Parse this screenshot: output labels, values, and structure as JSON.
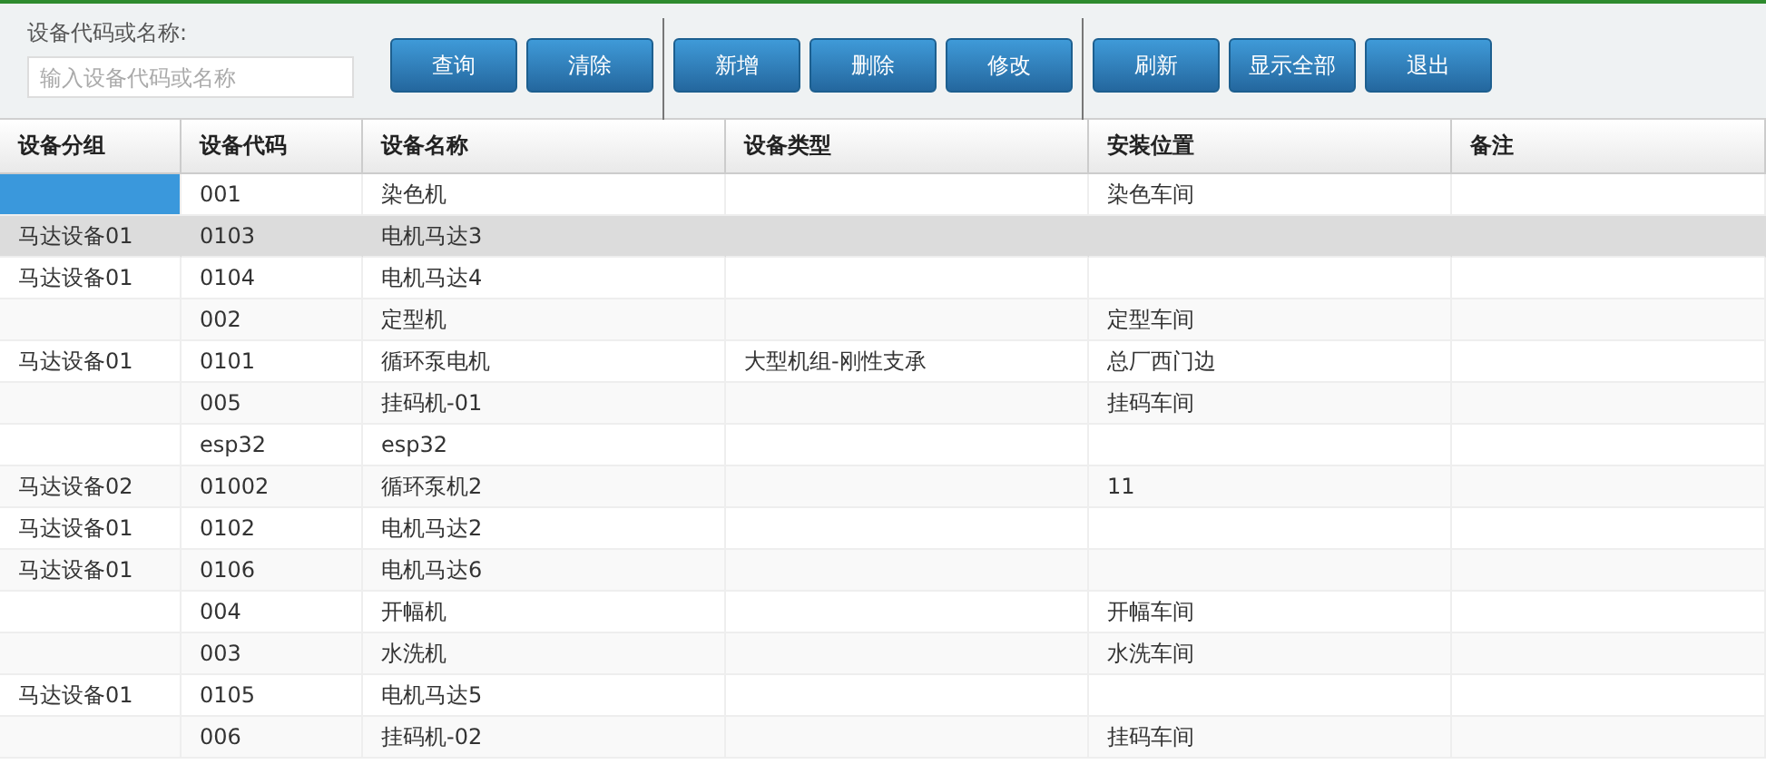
{
  "search": {
    "label": "设备代码或名称:",
    "placeholder": "输入设备代码或名称"
  },
  "button_groups": [
    [
      "查询",
      "清除"
    ],
    [
      "新增",
      "删除",
      "修改"
    ],
    [
      "刷新",
      "显示全部",
      "退出"
    ]
  ],
  "table": {
    "columns": [
      "设备分组",
      "设备代码",
      "设备名称",
      "设备类型",
      "安装位置",
      "备注"
    ],
    "rows": [
      {
        "cells": [
          "",
          "001",
          "染色机",
          "",
          "染色车间",
          ""
        ],
        "selected": true,
        "hovered": false
      },
      {
        "cells": [
          "马达设备01",
          "0103",
          "电机马达3",
          "",
          "",
          ""
        ],
        "selected": false,
        "hovered": true
      },
      {
        "cells": [
          "马达设备01",
          "0104",
          "电机马达4",
          "",
          "",
          ""
        ],
        "selected": false,
        "hovered": false
      },
      {
        "cells": [
          "",
          "002",
          "定型机",
          "",
          "定型车间",
          ""
        ],
        "selected": false,
        "hovered": false
      },
      {
        "cells": [
          "马达设备01",
          "0101",
          "循环泵电机",
          "大型机组-刚性支承",
          "总厂西门边",
          ""
        ],
        "selected": false,
        "hovered": false
      },
      {
        "cells": [
          "",
          "005",
          "挂码机-01",
          "",
          "挂码车间",
          ""
        ],
        "selected": false,
        "hovered": false
      },
      {
        "cells": [
          "",
          "esp32",
          "esp32",
          "",
          "",
          ""
        ],
        "selected": false,
        "hovered": false
      },
      {
        "cells": [
          "马达设备02",
          "01002",
          "循环泵机2",
          "",
          "11",
          ""
        ],
        "selected": false,
        "hovered": false
      },
      {
        "cells": [
          "马达设备01",
          "0102",
          "电机马达2",
          "",
          "",
          ""
        ],
        "selected": false,
        "hovered": false
      },
      {
        "cells": [
          "马达设备01",
          "0106",
          "电机马达6",
          "",
          "",
          ""
        ],
        "selected": false,
        "hovered": false
      },
      {
        "cells": [
          "",
          "004",
          "开幅机",
          "",
          "开幅车间",
          ""
        ],
        "selected": false,
        "hovered": false
      },
      {
        "cells": [
          "",
          "003",
          "水洗机",
          "",
          "水洗车间",
          ""
        ],
        "selected": false,
        "hovered": false
      },
      {
        "cells": [
          "马达设备01",
          "0105",
          "电机马达5",
          "",
          "",
          ""
        ],
        "selected": false,
        "hovered": false
      },
      {
        "cells": [
          "",
          "006",
          "挂码机-02",
          "",
          "挂码车间",
          ""
        ],
        "selected": false,
        "hovered": false
      }
    ]
  }
}
